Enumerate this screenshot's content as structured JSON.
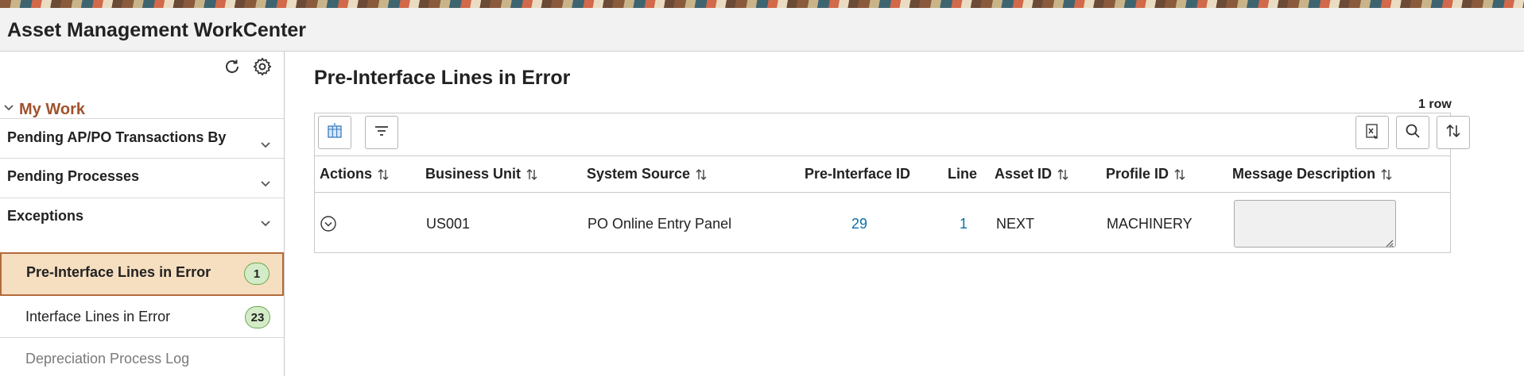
{
  "app": {
    "title": "Asset Management WorkCenter"
  },
  "sidebar": {
    "icons": [
      "refresh-icon",
      "gear-icon"
    ],
    "section": "My Work",
    "groups": [
      {
        "label": "Pending AP/PO Transactions By"
      },
      {
        "label": "Pending Processes"
      },
      {
        "label": "Exceptions"
      }
    ],
    "items": [
      {
        "label": "Pre-Interface Lines in Error",
        "count": "1",
        "active": true
      },
      {
        "label": "Interface Lines in Error",
        "count": "23"
      },
      {
        "label": "Depreciation Process Log"
      }
    ]
  },
  "main": {
    "title": "Pre-Interface Lines in Error",
    "row_count": "1 row",
    "toolbar_icons": [
      "grid-settings-icon",
      "filter-icon",
      "export-excel-icon",
      "search-icon",
      "sort-icon"
    ],
    "columns": [
      "Actions",
      "Business Unit",
      "System Source",
      "Pre-Interface ID",
      "Line",
      "Asset ID",
      "Profile ID",
      "Message Description"
    ],
    "rows": [
      {
        "business_unit": "US001",
        "system_source": "PO Online Entry Panel",
        "pre_interface_id": "29",
        "line": "1",
        "asset_id": "NEXT",
        "profile_id": "MACHINERY",
        "message_description": ""
      }
    ]
  },
  "colors": {
    "accent": "#a0522d",
    "link": "#0b6ea8",
    "active_bg": "#f6dec0",
    "active_border": "#b36a3a",
    "badge_bg": "#d4ebc8"
  }
}
